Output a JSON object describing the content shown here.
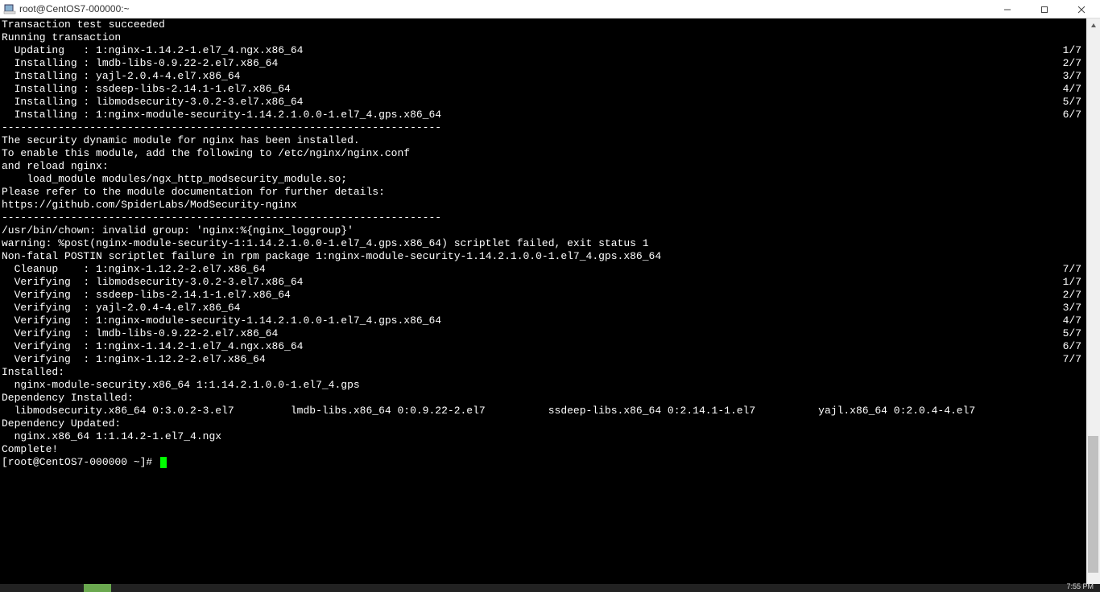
{
  "window": {
    "title": "root@CentOS7-000000:~"
  },
  "progress_lines": [
    {
      "left": "Transaction test succeeded",
      "right": ""
    },
    {
      "left": "Running transaction",
      "right": ""
    },
    {
      "left": "  Updating   : 1:nginx-1.14.2-1.el7_4.ngx.x86_64",
      "right": "1/7"
    },
    {
      "left": "  Installing : lmdb-libs-0.9.22-2.el7.x86_64",
      "right": "2/7"
    },
    {
      "left": "  Installing : yajl-2.0.4-4.el7.x86_64",
      "right": "3/7"
    },
    {
      "left": "  Installing : ssdeep-libs-2.14.1-1.el7.x86_64",
      "right": "4/7"
    },
    {
      "left": "  Installing : libmodsecurity-3.0.2-3.el7.x86_64",
      "right": "5/7"
    },
    {
      "left": "  Installing : 1:nginx-module-security-1.14.2.1.0.0-1.el7_4.gps.x86_64",
      "right": "6/7"
    }
  ],
  "sep": "----------------------------------------------------------------------",
  "mid_block": [
    "",
    "The security dynamic module for nginx has been installed.",
    "To enable this module, add the following to /etc/nginx/nginx.conf",
    "and reload nginx:",
    "",
    "    load_module modules/ngx_http_modsecurity_module.so;",
    "",
    "Please refer to the module documentation for further details:",
    "https://github.com/SpiderLabs/ModSecurity-nginx",
    ""
  ],
  "post_sep_block": [
    "/usr/bin/chown: invalid group: 'nginx:%{nginx_loggroup}'",
    "warning: %post(nginx-module-security-1:1.14.2.1.0.0-1.el7_4.gps.x86_64) scriptlet failed, exit status 1",
    "Non-fatal POSTIN scriptlet failure in rpm package 1:nginx-module-security-1.14.2.1.0.0-1.el7_4.gps.x86_64"
  ],
  "verify_lines": [
    {
      "left": "  Cleanup    : 1:nginx-1.12.2-2.el7.x86_64",
      "right": "7/7"
    },
    {
      "left": "  Verifying  : libmodsecurity-3.0.2-3.el7.x86_64",
      "right": "1/7"
    },
    {
      "left": "  Verifying  : ssdeep-libs-2.14.1-1.el7.x86_64",
      "right": "2/7"
    },
    {
      "left": "  Verifying  : yajl-2.0.4-4.el7.x86_64",
      "right": "3/7"
    },
    {
      "left": "  Verifying  : 1:nginx-module-security-1.14.2.1.0.0-1.el7_4.gps.x86_64",
      "right": "4/7"
    },
    {
      "left": "  Verifying  : lmdb-libs-0.9.22-2.el7.x86_64",
      "right": "5/7"
    },
    {
      "left": "  Verifying  : 1:nginx-1.14.2-1.el7_4.ngx.x86_64",
      "right": "6/7"
    },
    {
      "left": "  Verifying  : 1:nginx-1.12.2-2.el7.x86_64",
      "right": "7/7"
    }
  ],
  "summary": {
    "installed_header": "Installed:",
    "installed_line": "  nginx-module-security.x86_64 1:1.14.2.1.0.0-1.el7_4.gps",
    "dep_installed_header": "Dependency Installed:",
    "dep_installed_line": "  libmodsecurity.x86_64 0:3.0.2-3.el7         lmdb-libs.x86_64 0:0.9.22-2.el7          ssdeep-libs.x86_64 0:2.14.1-1.el7          yajl.x86_64 0:2.0.4-4.el7",
    "dep_updated_header": "Dependency Updated:",
    "dep_updated_line": "  nginx.x86_64 1:1.14.2-1.el7_4.ngx",
    "complete": "Complete!"
  },
  "prompt": "[root@CentOS7-000000 ~]# ",
  "taskbar": {
    "clock": "7:55 PM"
  },
  "scrollbar": {
    "thumb_top_pct": 74,
    "thumb_height_pct": 25
  }
}
